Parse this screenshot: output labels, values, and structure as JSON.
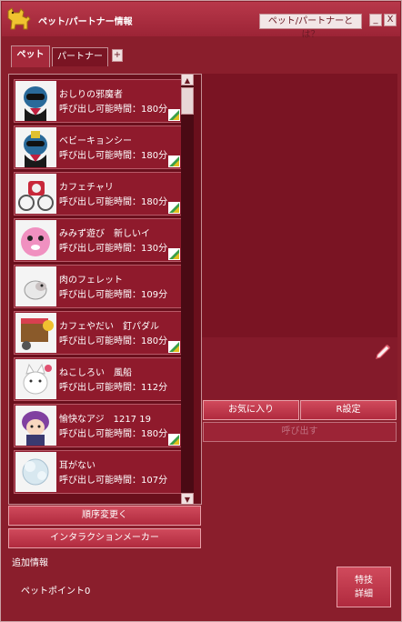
{
  "window": {
    "title": "ペット/パートナー情報",
    "help_label": "ペット/パートナーとは？",
    "minimize_label": "_",
    "close_label": "X"
  },
  "tabs": [
    {
      "label": "ペット",
      "active": true
    },
    {
      "label": "パートナー",
      "active": false
    }
  ],
  "tab_add_label": "+",
  "pets": [
    {
      "name": "おしりの邪魔者",
      "time": "呼び出し可能時間：180分",
      "icon": "blue-masked-pet-thumbnail"
    },
    {
      "name": "ベビーキョンシー",
      "time": "呼び出し可能時間：180分",
      "icon": "jiangshi-pet-thumbnail"
    },
    {
      "name": "カフェチャリ",
      "time": "呼び出し可能時間：180分",
      "icon": "cafe-bicycle-pet-thumbnail"
    },
    {
      "name": "みみず遊び　新しいイ",
      "time": "呼び出し可能時間：130分",
      "icon": "pink-creature-pet-thumbnail"
    },
    {
      "name": "肉のフェレット",
      "time": "呼び出し可能時間：109分",
      "icon": "ferret-pet-thumbnail"
    },
    {
      "name": "カフェやだい　釘パダル",
      "time": "呼び出し可能時間：180分",
      "icon": "cafe-stall-pet-thumbnail"
    },
    {
      "name": "ねこしろい　風船",
      "time": "呼び出し可能時間：112分",
      "icon": "white-cat-pet-thumbnail"
    },
    {
      "name": "愉快なアジ　1217 19",
      "time": "呼び出し可能時間：180分",
      "icon": "purple-hair-pet-thumbnail"
    },
    {
      "name": "耳がない",
      "time": "呼び出し可能時間：107分",
      "icon": "white-ghost-pet-thumbnail"
    }
  ],
  "buttons": {
    "favorite": "お気に入り",
    "reset": "R設定",
    "summon": "呼び出す",
    "reorder": "順序変更く",
    "interaction": "インタラクションメーカー",
    "skill_line1": "特技",
    "skill_line2": "詳細"
  },
  "extra_info_label": "追加情報",
  "pet_points_label": "ペットポイント0",
  "colors": {
    "window_bg": "#8a1e2c",
    "titlebar": "#b8384a",
    "button": "#c03a4e",
    "list_bg": "#6a0f1c"
  }
}
